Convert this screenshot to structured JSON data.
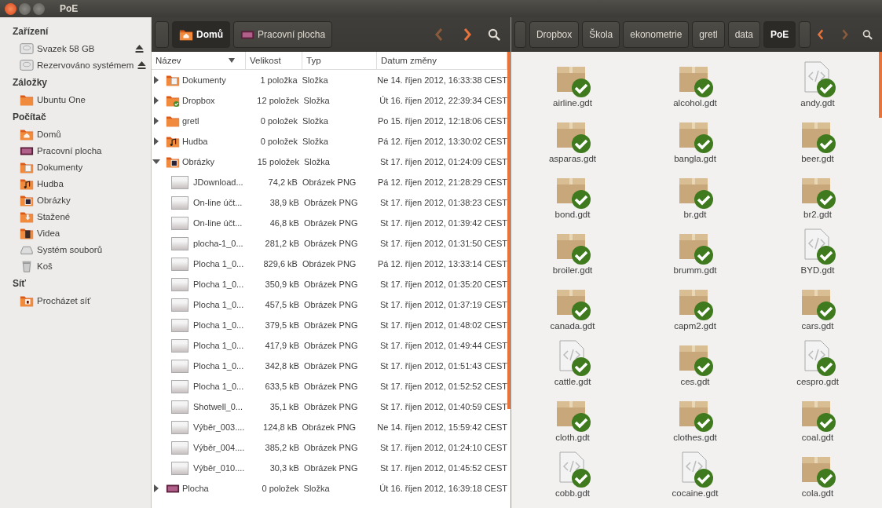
{
  "window": {
    "title": "PoE"
  },
  "sidebar": {
    "sections": [
      {
        "heading": "Zařízení",
        "items": [
          {
            "label": "Svazek 58 GB",
            "kind": "drive"
          },
          {
            "label": "Rezervováno systémem",
            "kind": "drive"
          }
        ]
      },
      {
        "heading": "Záložky",
        "items": [
          {
            "label": "Ubuntu One",
            "kind": "folder"
          }
        ]
      },
      {
        "heading": "Počítač",
        "items": [
          {
            "label": "Domů",
            "kind": "home"
          },
          {
            "label": "Pracovní plocha",
            "kind": "desktop"
          },
          {
            "label": "Dokumenty",
            "kind": "documents"
          },
          {
            "label": "Hudba",
            "kind": "music"
          },
          {
            "label": "Obrázky",
            "kind": "pictures"
          },
          {
            "label": "Stažené",
            "kind": "downloads"
          },
          {
            "label": "Videa",
            "kind": "videos"
          },
          {
            "label": "Systém souborů",
            "kind": "filesystem"
          },
          {
            "label": "Koš",
            "kind": "trash"
          }
        ]
      },
      {
        "heading": "Síť",
        "items": [
          {
            "label": "Procházet síť",
            "kind": "network"
          }
        ]
      }
    ]
  },
  "left_pane": {
    "pathbar": [
      {
        "label": "Domů",
        "kind": "home",
        "selected": true
      },
      {
        "label": "Pracovní plocha",
        "kind": "desktop",
        "selected": false
      }
    ],
    "back": {
      "disabled": true
    },
    "forward": {
      "disabled": false
    },
    "columns": [
      "Název",
      "Velikost",
      "Typ",
      "Datum změny"
    ],
    "rows": [
      {
        "name": "Dokumenty",
        "kind": "documents",
        "size": "1 položka",
        "type": "Složka",
        "modified": "Ne 14. říjen 2012, 16:33:38 CEST",
        "expanded": false
      },
      {
        "name": "Dropbox",
        "kind": "dropbox",
        "size": "12 položek",
        "type": "Složka",
        "modified": "Út 16. říjen 2012, 22:39:34 CEST",
        "expanded": false
      },
      {
        "name": "gretl",
        "kind": "folder",
        "size": "0 položek",
        "type": "Složka",
        "modified": "Po 15. říjen 2012, 12:18:06 CEST",
        "expanded": false
      },
      {
        "name": "Hudba",
        "kind": "music",
        "size": "0 položek",
        "type": "Složka",
        "modified": "Pá 12. říjen 2012, 13:30:02 CEST",
        "expanded": false
      },
      {
        "name": "Obrázky",
        "kind": "pictures",
        "size": "15 položek",
        "type": "Složka",
        "modified": "St 17. říjen 2012, 01:24:09 CEST",
        "expanded": true,
        "children": [
          {
            "name": "JDownload...",
            "kind": "image",
            "size": "74,2 kB",
            "type": "Obrázek PNG",
            "modified": "Pá 12. říjen 2012, 21:28:29 CEST"
          },
          {
            "name": "On-line účt...",
            "kind": "image",
            "size": "38,9 kB",
            "type": "Obrázek PNG",
            "modified": "St 17. říjen 2012, 01:38:23 CEST"
          },
          {
            "name": "On-line účt...",
            "kind": "image",
            "size": "46,8 kB",
            "type": "Obrázek PNG",
            "modified": "St 17. říjen 2012, 01:39:42 CEST"
          },
          {
            "name": "plocha-1_0...",
            "kind": "image",
            "size": "281,2 kB",
            "type": "Obrázek PNG",
            "modified": "St 17. říjen 2012, 01:31:50 CEST"
          },
          {
            "name": "Plocha 1_0...",
            "kind": "image",
            "size": "829,6 kB",
            "type": "Obrázek PNG",
            "modified": "Pá 12. říjen 2012, 13:33:14 CEST"
          },
          {
            "name": "Plocha 1_0...",
            "kind": "image",
            "size": "350,9 kB",
            "type": "Obrázek PNG",
            "modified": "St 17. říjen 2012, 01:35:20 CEST"
          },
          {
            "name": "Plocha 1_0...",
            "kind": "image",
            "size": "457,5 kB",
            "type": "Obrázek PNG",
            "modified": "St 17. říjen 2012, 01:37:19 CEST"
          },
          {
            "name": "Plocha 1_0...",
            "kind": "image",
            "size": "379,5 kB",
            "type": "Obrázek PNG",
            "modified": "St 17. říjen 2012, 01:48:02 CEST"
          },
          {
            "name": "Plocha 1_0...",
            "kind": "image",
            "size": "417,9 kB",
            "type": "Obrázek PNG",
            "modified": "St 17. říjen 2012, 01:49:44 CEST"
          },
          {
            "name": "Plocha 1_0...",
            "kind": "image",
            "size": "342,8 kB",
            "type": "Obrázek PNG",
            "modified": "St 17. říjen 2012, 01:51:43 CEST"
          },
          {
            "name": "Plocha 1_0...",
            "kind": "image",
            "size": "633,5 kB",
            "type": "Obrázek PNG",
            "modified": "St 17. říjen 2012, 01:52:52 CEST"
          },
          {
            "name": "Shotwell_0...",
            "kind": "image",
            "size": "35,1 kB",
            "type": "Obrázek PNG",
            "modified": "St 17. říjen 2012, 01:40:59 CEST"
          },
          {
            "name": "Výběr_003....",
            "kind": "image",
            "size": "124,8 kB",
            "type": "Obrázek PNG",
            "modified": "Ne 14. říjen 2012, 15:59:42 CEST"
          },
          {
            "name": "Výběr_004....",
            "kind": "image",
            "size": "385,2 kB",
            "type": "Obrázek PNG",
            "modified": "St 17. říjen 2012, 01:24:10 CEST"
          },
          {
            "name": "Výběr_010....",
            "kind": "image",
            "size": "30,3 kB",
            "type": "Obrázek PNG",
            "modified": "St 17. říjen 2012, 01:45:52 CEST"
          }
        ]
      },
      {
        "name": "Plocha",
        "kind": "desktop",
        "size": "0 položek",
        "type": "Složka",
        "modified": "Út 16. říjen 2012, 16:39:18 CEST",
        "expanded": false
      }
    ]
  },
  "right_pane": {
    "pathbar": [
      {
        "label": "Dropbox",
        "selected": false
      },
      {
        "label": "Škola",
        "selected": false
      },
      {
        "label": "ekonometrie",
        "selected": false
      },
      {
        "label": "gretl",
        "selected": false
      },
      {
        "label": "data",
        "selected": false
      },
      {
        "label": "PoE",
        "selected": true
      }
    ],
    "back": {
      "disabled": false
    },
    "forward": {
      "disabled": true
    },
    "items": [
      {
        "name": "airline.gdt",
        "kind": "package"
      },
      {
        "name": "alcohol.gdt",
        "kind": "package"
      },
      {
        "name": "andy.gdt",
        "kind": "document"
      },
      {
        "name": "asparas.gdt",
        "kind": "package"
      },
      {
        "name": "bangla.gdt",
        "kind": "package"
      },
      {
        "name": "beer.gdt",
        "kind": "package"
      },
      {
        "name": "bond.gdt",
        "kind": "package"
      },
      {
        "name": "br.gdt",
        "kind": "package"
      },
      {
        "name": "br2.gdt",
        "kind": "package"
      },
      {
        "name": "broiler.gdt",
        "kind": "package"
      },
      {
        "name": "brumm.gdt",
        "kind": "package"
      },
      {
        "name": "BYD.gdt",
        "kind": "document"
      },
      {
        "name": "canada.gdt",
        "kind": "package"
      },
      {
        "name": "capm2.gdt",
        "kind": "package"
      },
      {
        "name": "cars.gdt",
        "kind": "package"
      },
      {
        "name": "cattle.gdt",
        "kind": "document"
      },
      {
        "name": "ces.gdt",
        "kind": "package"
      },
      {
        "name": "cespro.gdt",
        "kind": "document"
      },
      {
        "name": "cloth.gdt",
        "kind": "package"
      },
      {
        "name": "clothes.gdt",
        "kind": "package"
      },
      {
        "name": "coal.gdt",
        "kind": "package"
      },
      {
        "name": "cobb.gdt",
        "kind": "document"
      },
      {
        "name": "cocaine.gdt",
        "kind": "document"
      },
      {
        "name": "cola.gdt",
        "kind": "package"
      }
    ]
  }
}
